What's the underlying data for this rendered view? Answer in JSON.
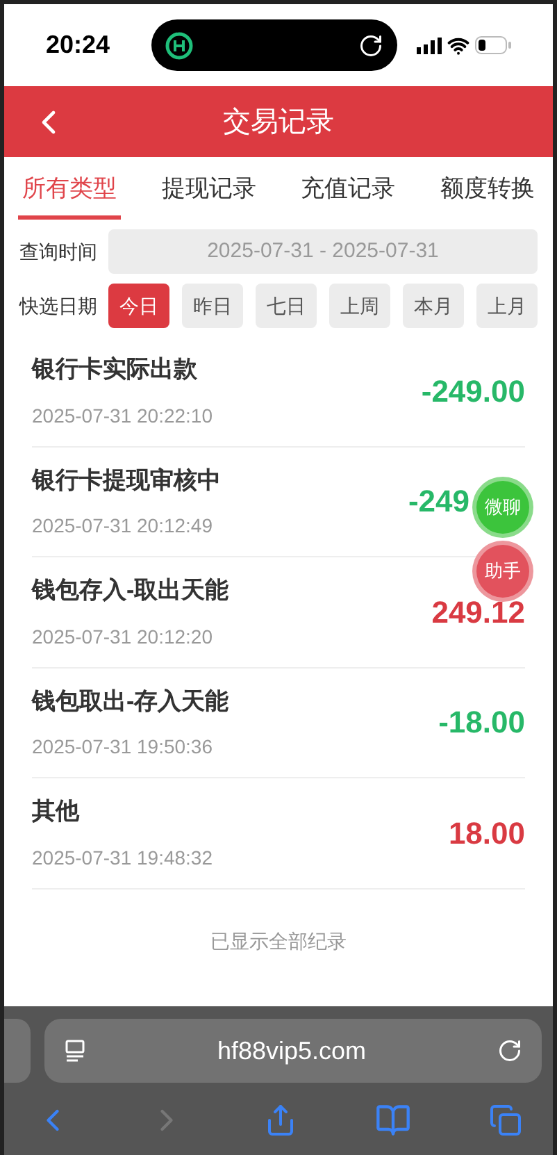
{
  "status_bar": {
    "time": "20:24"
  },
  "header": {
    "title": "交易记录"
  },
  "tabs": [
    {
      "label": "所有类型",
      "selected": true
    },
    {
      "label": "提现记录",
      "selected": false
    },
    {
      "label": "充值记录",
      "selected": false
    },
    {
      "label": "额度转换",
      "selected": false
    }
  ],
  "query": {
    "label": "查询时间",
    "value": "2025-07-31 - 2025-07-31"
  },
  "quick_dates": {
    "label": "快选日期",
    "options": [
      {
        "label": "今日",
        "selected": true
      },
      {
        "label": "昨日",
        "selected": false
      },
      {
        "label": "七日",
        "selected": false
      },
      {
        "label": "上周",
        "selected": false
      },
      {
        "label": "本月",
        "selected": false
      },
      {
        "label": "上月",
        "selected": false
      }
    ]
  },
  "transactions": [
    {
      "title": "银行卡实际出款",
      "time": "2025-07-31 20:22:10",
      "amount": "-249.00",
      "color": "#27b868",
      "covered": false
    },
    {
      "title": "银行卡提现审核中",
      "time": "2025-07-31 20:12:49",
      "amount": "-249",
      "color": "#27b868",
      "covered": true
    },
    {
      "title": "钱包存入-取出天能",
      "time": "2025-07-31 20:12:20",
      "amount": "249.12",
      "color": "#d93a42",
      "covered": false
    },
    {
      "title": "钱包取出-存入天能",
      "time": "2025-07-31 19:50:36",
      "amount": "-18.00",
      "color": "#27b868",
      "covered": false
    },
    {
      "title": "其他",
      "time": "2025-07-31 19:48:32",
      "amount": "18.00",
      "color": "#d93a42",
      "covered": false
    }
  ],
  "footer_note": "已显示全部纪录",
  "floating_buttons": [
    {
      "label": "微聊",
      "color": "#3cc43c"
    },
    {
      "label": "助手",
      "color": "#e2525d"
    }
  ],
  "browser": {
    "url": "hf88vip5.com"
  }
}
